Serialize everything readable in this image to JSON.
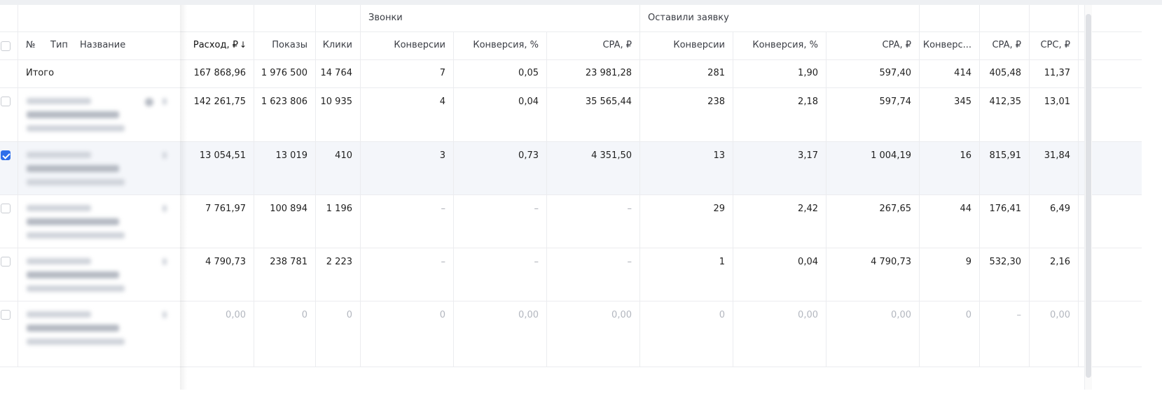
{
  "header": {
    "groups": {
      "calls": "Звонки",
      "applications": "Оставили заявку"
    },
    "columns": {
      "number": "№",
      "type": "Тип",
      "name": "Название",
      "spend": "Расход, ₽",
      "spend_sort": "↓",
      "impressions": "Показы",
      "clicks": "Клики",
      "calls_conv": "Конверсии",
      "calls_conv_pct": "Конверсия, %",
      "calls_cpa": "CPA, ₽",
      "app_conv": "Конверсии",
      "app_conv_pct": "Конверсия, %",
      "app_cpa": "CPA, ₽",
      "total_conv": "Конверс...",
      "total_cpa": "CPA, ₽",
      "cpc": "CPC, ₽"
    }
  },
  "totals": {
    "label": "Итого",
    "spend": "167 868,96",
    "impressions": "1 976 500",
    "clicks": "14 764",
    "calls_conv": "7",
    "calls_conv_pct": "0,05",
    "calls_cpa": "23 981,28",
    "app_conv": "281",
    "app_conv_pct": "1,90",
    "app_cpa": "597,40",
    "total_conv": "414",
    "total_cpa": "405,48",
    "cpc": "11,37"
  },
  "rows": [
    {
      "selected": false,
      "spend": "142 261,75",
      "impressions": "1 623 806",
      "clicks": "10 935",
      "calls_conv": "4",
      "calls_conv_pct": "0,04",
      "calls_cpa": "35 565,44",
      "app_conv": "238",
      "app_conv_pct": "2,18",
      "app_cpa": "597,74",
      "total_conv": "345",
      "total_cpa": "412,35",
      "cpc": "13,01"
    },
    {
      "selected": true,
      "spend": "13 054,51",
      "impressions": "13 019",
      "clicks": "410",
      "calls_conv": "3",
      "calls_conv_pct": "0,73",
      "calls_cpa": "4 351,50",
      "app_conv": "13",
      "app_conv_pct": "3,17",
      "app_cpa": "1 004,19",
      "total_conv": "16",
      "total_cpa": "815,91",
      "cpc": "31,84"
    },
    {
      "selected": false,
      "spend": "7 761,97",
      "impressions": "100 894",
      "clicks": "1 196",
      "calls_conv": "–",
      "calls_conv_pct": "–",
      "calls_cpa": "–",
      "app_conv": "29",
      "app_conv_pct": "2,42",
      "app_cpa": "267,65",
      "total_conv": "44",
      "total_cpa": "176,41",
      "cpc": "6,49"
    },
    {
      "selected": false,
      "spend": "4 790,73",
      "impressions": "238 781",
      "clicks": "2 223",
      "calls_conv": "–",
      "calls_conv_pct": "–",
      "calls_cpa": "–",
      "app_conv": "1",
      "app_conv_pct": "0,04",
      "app_cpa": "4 790,73",
      "total_conv": "9",
      "total_cpa": "532,30",
      "cpc": "2,16"
    },
    {
      "selected": false,
      "muted": true,
      "spend": "0,00",
      "impressions": "0",
      "clicks": "0",
      "calls_conv": "0",
      "calls_conv_pct": "0,00",
      "calls_cpa": "0,00",
      "app_conv": "0",
      "app_conv_pct": "0,00",
      "app_cpa": "0,00",
      "total_conv": "0",
      "total_cpa": "–",
      "cpc": "0,00"
    }
  ],
  "colors": {
    "accent": "#2f6fea",
    "border": "#ebecef",
    "muted": "#b3b7bf",
    "selected_row": "#f4f6fa"
  }
}
